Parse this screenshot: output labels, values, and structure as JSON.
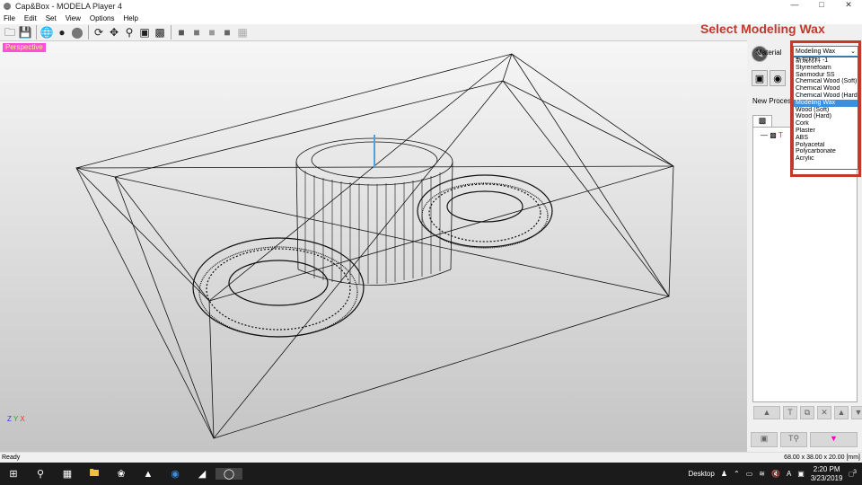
{
  "window": {
    "title": "Cap&Box - MODELA Player 4"
  },
  "menu": [
    "File",
    "Edit",
    "Set",
    "View",
    "Options",
    "Help"
  ],
  "toolbar": {
    "icons": [
      "open-icon",
      "save-icon",
      "wireframe-icon",
      "shaded-sphere-grid-icon",
      "shaded-sphere-icon",
      "rotate-icon",
      "move-icon",
      "zoom-icon",
      "fit-icon",
      "zoom-region-icon",
      "view-iso-icon",
      "view-front-icon",
      "view-right-icon",
      "view-left-icon",
      "view-pattern-icon"
    ]
  },
  "callout": "Select Modeling Wax",
  "viewport": {
    "label": "Perspective",
    "axes": {
      "z": "Z",
      "y": "Y",
      "x": "X"
    }
  },
  "panel": {
    "material_label": "Material",
    "material_selected": "Modeling Wax",
    "material_options": [
      "新規材料 -1",
      "Styrenefoam",
      "Sanmodur SS",
      "Chemical Wood (Soft)",
      "Chemical Wood",
      "Chemical Wood (Hard)",
      "Modeling Wax",
      "Wood (Soft)",
      "Wood (Hard)",
      "Cork",
      "Plaster",
      "ABS",
      "Polyacetal",
      "Polycarbonate",
      "Acrylic"
    ],
    "highlight_index": 6,
    "new_process_label": "New Process"
  },
  "status": {
    "left": "Ready",
    "right": "68.00 x 38.00 x 20.00 [mm]"
  },
  "taskbar": {
    "desktop": "Desktop",
    "time": "2:20 PM",
    "date": "3/23/2019",
    "notifications": "3"
  },
  "colors": {
    "callout": "#c0392b",
    "highlight": "#3b8fe0",
    "label_bg": "#ff4fd8"
  }
}
